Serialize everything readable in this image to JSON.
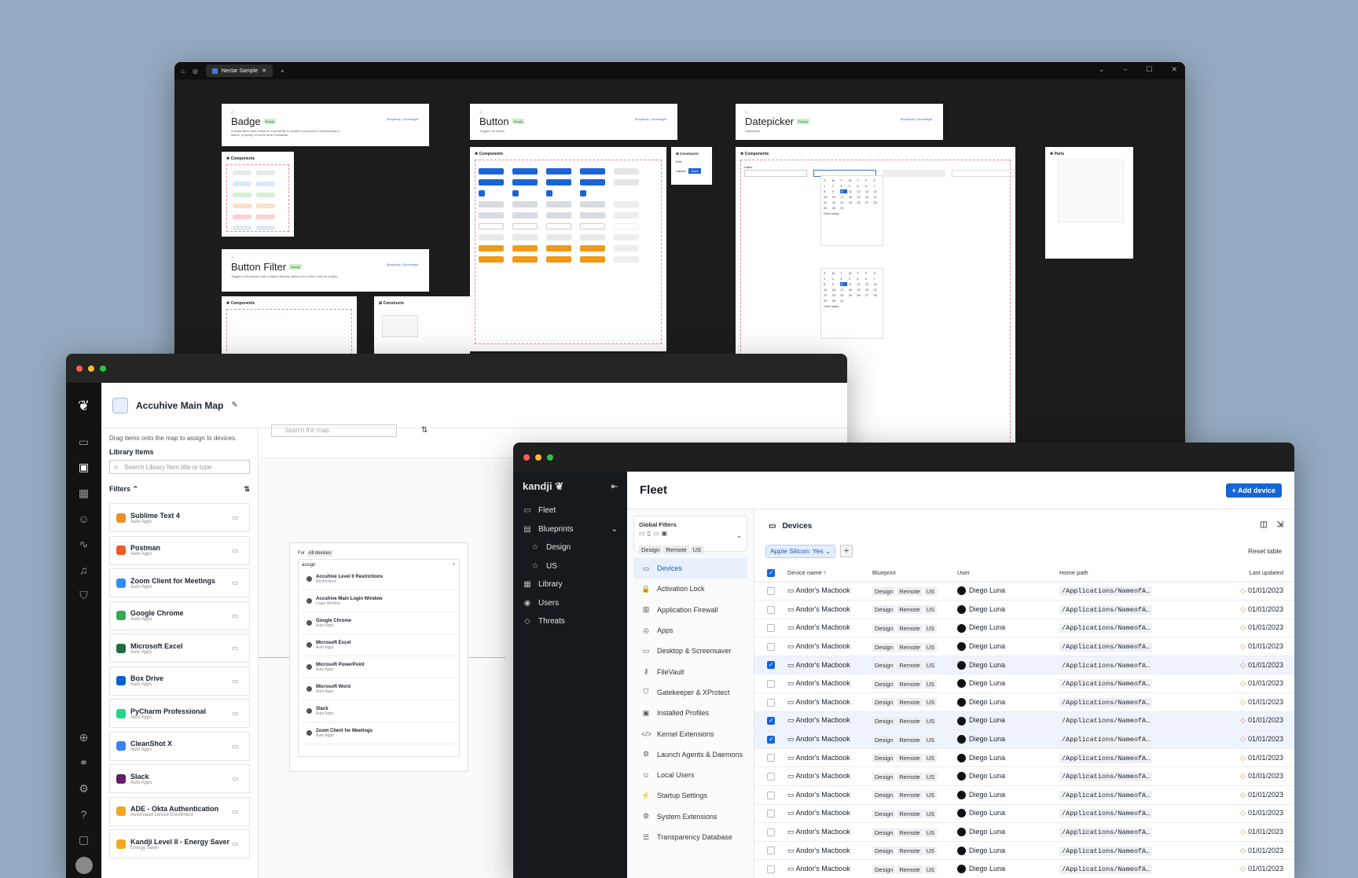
{
  "nectar": {
    "tab": "Nectar Sample",
    "badge": {
      "title": "Badge",
      "status": "Ready",
      "desc": "A small label used inside or in proximity to another component, representing a status, property, or some other metadata",
      "links": "Storybook | Zeroheight",
      "components_title": "Components",
      "chips": [
        "Badge label",
        "Badge label",
        "Badge label",
        "Badge label",
        "Badge label",
        "Badge label",
        "Badge label",
        "Badge label",
        "Badge label",
        "Badge label",
        "Badge label",
        "Badge label"
      ]
    },
    "button": {
      "title": "Button",
      "status": "Ready",
      "desc": "Triggers an action",
      "links": "Storybook | Zeroheight",
      "components_title": "Components",
      "constructs_title": "Constructs",
      "edit": "Edit",
      "cancel": "Cancel",
      "save": "Save"
    },
    "buttonfilter": {
      "title": "Button Filter",
      "status": "Ready",
      "desc": "Triggers a dropdown that contains filtering options for a view, such as a table",
      "links": "Storybook | Zeroheight",
      "components_title": "Components",
      "constructs_title": "Constructs"
    },
    "datepicker": {
      "title": "Datepicker",
      "status": "Ready",
      "desc": "Datepicker",
      "links": "Storybook | Zeroheight",
      "components_title": "Components",
      "parts_title": "Parts",
      "label": "Label",
      "view_today": "View today",
      "date_value": "01/01/2023"
    }
  },
  "accuhive": {
    "title": "Accuhive Main Map",
    "hint": "Drag items onto the map to assign to devices.",
    "library_heading": "Library Items",
    "search_placeholder": "Search Library Item title or type",
    "filters": "Filters",
    "map_search": "Search the map",
    "library_items": [
      {
        "name": "Sublime Text 4",
        "cat": "Auto Apps",
        "color": "#f28c28"
      },
      {
        "name": "Postman",
        "cat": "Auto Apps",
        "color": "#ef5b25"
      },
      {
        "name": "Zoom Client for Meetings",
        "cat": "Auto Apps",
        "color": "#2d8cff"
      },
      {
        "name": "Google Chrome",
        "cat": "Auto Apps",
        "color": "#34a853"
      },
      {
        "name": "Microsoft Excel",
        "cat": "Auto Apps",
        "color": "#1d6f42"
      },
      {
        "name": "Box Drive",
        "cat": "Auto Apps",
        "color": "#0061d5"
      },
      {
        "name": "PyCharm Professional",
        "cat": "Auto Apps",
        "color": "#21d789"
      },
      {
        "name": "CleanShot X",
        "cat": "Auto Apps",
        "color": "#3b82f6"
      },
      {
        "name": "Slack",
        "cat": "Auto Apps",
        "color": "#611f69"
      },
      {
        "name": "ADE - Okta Authentication",
        "cat": "Automated Device Enrollment",
        "color": "#f5a623"
      },
      {
        "name": "Kandji Level II - Energy Saver",
        "cat": "Energy Saver",
        "color": "#f5a623"
      }
    ],
    "map_card": {
      "for": "For",
      "all_devices": "All devices",
      "assign": "assign",
      "items": [
        {
          "name": "Accuhive Level II Restrictions",
          "cat": "Restrictions"
        },
        {
          "name": "Accuhive Main Login Window",
          "cat": "Login Window"
        },
        {
          "name": "Google Chrome",
          "cat": "Auto Apps"
        },
        {
          "name": "Microsoft Excel",
          "cat": "Auto Apps"
        },
        {
          "name": "Microsoft PowerPoint",
          "cat": "Auto Apps"
        },
        {
          "name": "Microsoft Word",
          "cat": "Auto Apps"
        },
        {
          "name": "Slack",
          "cat": "Auto Apps"
        },
        {
          "name": "Zoom Client for Meetings",
          "cat": "Auto Apps"
        }
      ]
    }
  },
  "kandji": {
    "logo": "kandji",
    "nav": [
      {
        "label": "Fleet",
        "icon": "▭",
        "sub": false
      },
      {
        "label": "Blueprints",
        "icon": "▤",
        "sub": false
      },
      {
        "label": "Design",
        "icon": "☆",
        "sub": true
      },
      {
        "label": "US",
        "icon": "☆",
        "sub": true
      },
      {
        "label": "Library",
        "icon": "▦",
        "sub": false
      },
      {
        "label": "Users",
        "icon": "◉",
        "sub": false
      },
      {
        "label": "Threats",
        "icon": "◇",
        "sub": false
      }
    ],
    "page_title": "Fleet",
    "add_device": "Add device",
    "global_filters": "Global Filters",
    "gf_chips": [
      "Design",
      "Remote",
      "US"
    ],
    "sub_nav": [
      "Devices",
      "Activation Lock",
      "Application Firewall",
      "Apps",
      "Desktop & Screensaver",
      "FileVault",
      "Gatekeeper & XProtect",
      "Installed Profiles",
      "Kernel Extensions",
      "Launch Agents & Daemons",
      "Local Users",
      "Startup Settings",
      "System Extensions",
      "Transparency Database"
    ],
    "devices_title": "Devices",
    "filter_chip": "Apple Silicon: Yes",
    "reset_table": "Reset table",
    "columns": {
      "device": "Device name",
      "blueprint": "Blueprint",
      "user": "User",
      "home": "Home path",
      "updated": "Last updated"
    },
    "row": {
      "device": "Andor's Macbook",
      "tags": [
        "Design",
        "Remote",
        "US"
      ],
      "user": "Diego Luna",
      "path": "/Applications/NameofA…",
      "date": "01/01/2023"
    },
    "selected_rows": [
      4,
      7,
      8
    ],
    "row_count": 16
  }
}
